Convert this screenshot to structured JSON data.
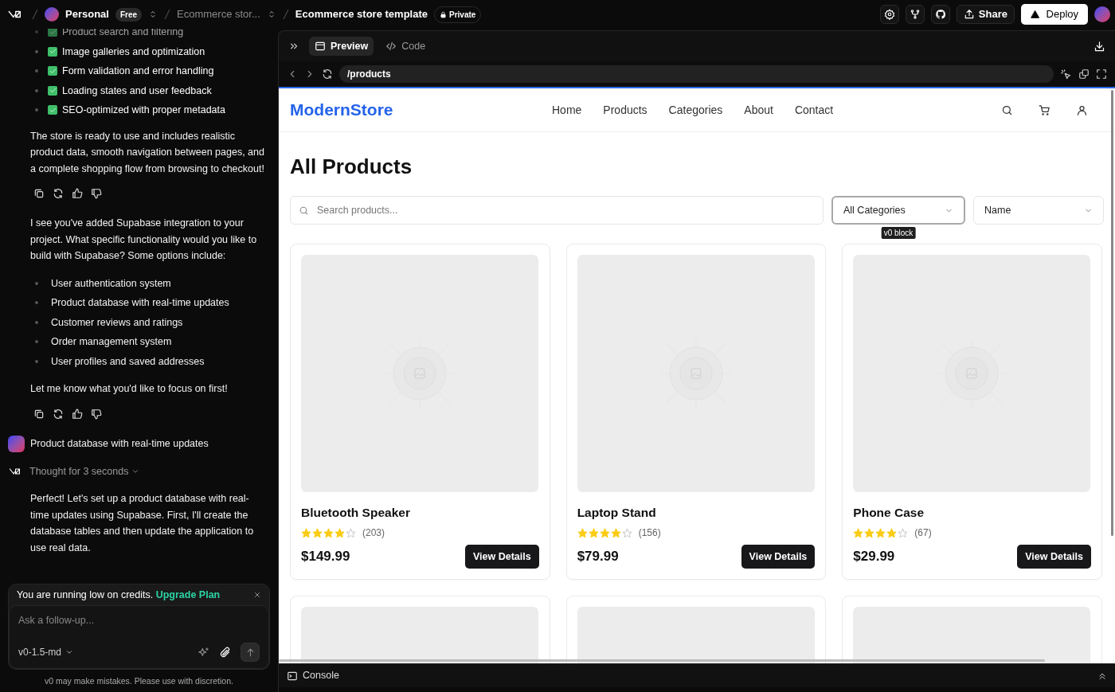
{
  "top_bar": {
    "workspace": "Personal",
    "plan": "Free",
    "project": "Ecommerce stor...",
    "title": "Ecommerce store template",
    "visibility": "Private",
    "share": "Share",
    "deploy": "Deploy"
  },
  "chat": {
    "items": [
      {
        "kind": "checklist",
        "items": [
          {
            "text": "Product search and filtering",
            "checked": true,
            "faded": true
          },
          {
            "text": "Image galleries and optimization",
            "checked": true,
            "faded": false
          },
          {
            "text": "Form validation and error handling",
            "checked": true,
            "faded": false
          },
          {
            "text": "Loading states and user feedback",
            "checked": true,
            "faded": false
          },
          {
            "text": "SEO-optimized with proper metadata",
            "checked": true,
            "faded": false
          }
        ]
      },
      {
        "kind": "paragraph",
        "text": "The store is ready to use and includes realistic product data, smooth navigation between pages, and a complete shopping flow from browsing to checkout!"
      },
      {
        "kind": "actions"
      },
      {
        "kind": "paragraph",
        "text": "I see you've added Supabase integration to your project. What specific functionality would you like to build with Supabase? Some options include:"
      },
      {
        "kind": "bullets",
        "items": [
          "User authentication system",
          "Product database with real-time updates",
          "Customer reviews and ratings",
          "Order management system",
          "User profiles and saved addresses"
        ]
      },
      {
        "kind": "paragraph",
        "text": "Let me know what you'd like to focus on first!"
      },
      {
        "kind": "actions"
      },
      {
        "kind": "user",
        "text": "Product database with real-time updates"
      },
      {
        "kind": "thought",
        "text": "Thought for 3 seconds"
      },
      {
        "kind": "paragraph",
        "text": "Perfect! Let's set up a product database with real-time updates using Supabase. First, I'll create the database tables and then update the application to use real data."
      }
    ],
    "banner": {
      "text": "You are running low on credits.",
      "link": "Upgrade Plan"
    },
    "composer": {
      "placeholder": "Ask a follow-up...",
      "model": "v0-1.5-md"
    },
    "disclaimer": "v0 may make mistakes. Please use with discretion."
  },
  "preview": {
    "tabs": [
      {
        "label": "Preview",
        "selected": true
      },
      {
        "label": "Code",
        "selected": false
      }
    ],
    "url": "/products",
    "console": "Console"
  },
  "store": {
    "brand": "ModernStore",
    "nav": [
      "Home",
      "Products",
      "Categories",
      "About",
      "Contact"
    ],
    "heading": "All Products",
    "search": {
      "placeholder": "Search products..."
    },
    "filters": [
      {
        "value": "All Categories",
        "focused": true
      },
      {
        "value": "Name",
        "focused": false
      }
    ],
    "tooltip": "v0 block",
    "products": [
      {
        "kind": "full",
        "name": "Bluetooth Speaker",
        "stars": 4,
        "reviews": "(203)",
        "price": "$149.99",
        "button": "View Details"
      },
      {
        "kind": "full",
        "name": "Laptop Stand",
        "stars": 4,
        "reviews": "(156)",
        "price": "$79.99",
        "button": "View Details"
      },
      {
        "kind": "full",
        "name": "Phone Case",
        "stars": 4,
        "reviews": "(67)",
        "price": "$29.99",
        "button": "View Details"
      },
      {
        "kind": "partial"
      },
      {
        "kind": "partial"
      },
      {
        "kind": "partial"
      }
    ]
  }
}
